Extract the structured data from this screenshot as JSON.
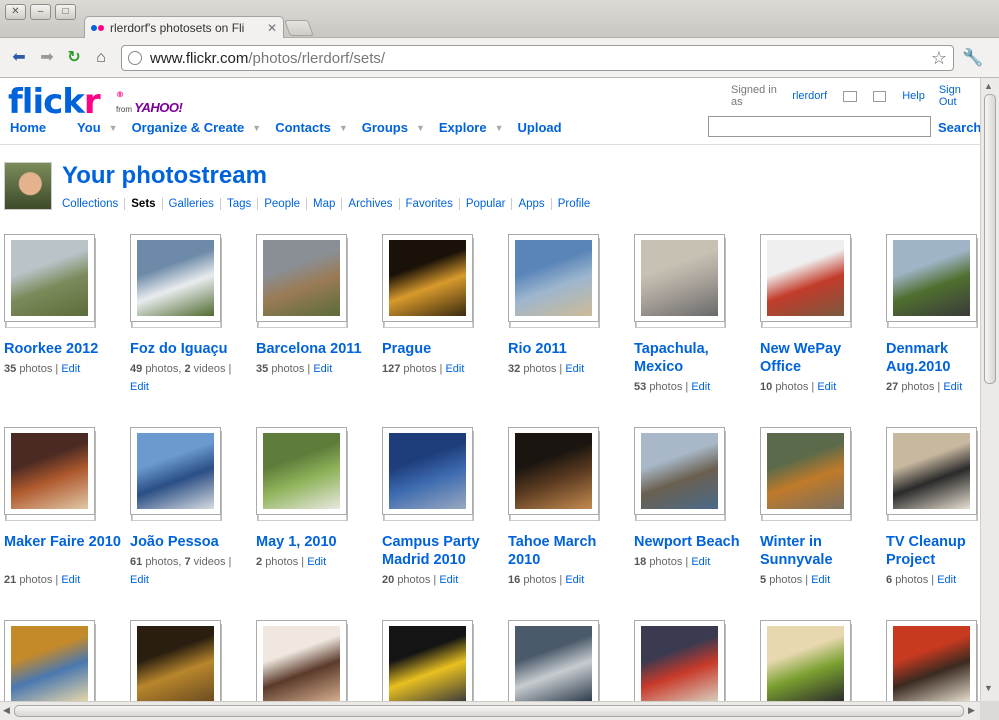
{
  "browser": {
    "tab_title": "rlerdorf's photosets on Fli",
    "url_host": "www.flickr.com",
    "url_path": "/photos/rlerdorf/sets/"
  },
  "header": {
    "logo_text_1": "flick",
    "logo_text_2": "r",
    "logo_from": "from",
    "logo_yahoo": "YAHOO!",
    "signed_in_prefix": "Signed in as",
    "username": "rlerdorf",
    "help": "Help",
    "sign_out": "Sign Out",
    "nav": [
      "Home",
      "You",
      "Organize & Create",
      "Contacts",
      "Groups",
      "Explore",
      "Upload"
    ],
    "search_label": "Search",
    "search_value": ""
  },
  "page": {
    "title": "Your photostream",
    "subnav": [
      "Collections",
      "Sets",
      "Galleries",
      "Tags",
      "People",
      "Map",
      "Archives",
      "Favorites",
      "Popular",
      "Apps",
      "Profile"
    ],
    "active_subnav": "Sets"
  },
  "sets": [
    {
      "title": "Roorkee 2012",
      "photos": "35",
      "videos": "",
      "colors": [
        "#b9c4c9",
        "#7a8a5a",
        "#5d6c3b"
      ]
    },
    {
      "title": "Foz do Iguaçu",
      "photos": "49",
      "videos": "2",
      "colors": [
        "#6d8aa8",
        "#e9ecef",
        "#4f6b2e"
      ]
    },
    {
      "title": "Barcelona 2011",
      "photos": "35",
      "videos": "",
      "colors": [
        "#8a8f96",
        "#9a7b55",
        "#5b6b3a"
      ]
    },
    {
      "title": "Prague",
      "photos": "127",
      "videos": "",
      "colors": [
        "#1a1208",
        "#d89a2c",
        "#3a2a10"
      ]
    },
    {
      "title": "Rio 2011",
      "photos": "32",
      "videos": "",
      "colors": [
        "#5a85b8",
        "#9db6cf",
        "#cdbb96"
      ]
    },
    {
      "title": "Tapachula, Mexico",
      "photos": "53",
      "videos": "",
      "colors": [
        "#c7c1b4",
        "#a9a29a",
        "#6a6a6a"
      ]
    },
    {
      "title": "New WePay Office",
      "photos": "10",
      "videos": "",
      "colors": [
        "#efefef",
        "#c23b2a",
        "#7a5a40"
      ]
    },
    {
      "title": "Denmark Aug.2010",
      "photos": "27",
      "videos": "",
      "colors": [
        "#9fb4c6",
        "#4f6f2f",
        "#3a3a3a"
      ]
    },
    {
      "title": "Maker Faire 2010",
      "photos": "21",
      "videos": "",
      "colors": [
        "#4a2a22",
        "#b05a2e",
        "#e0c8a8"
      ]
    },
    {
      "title": "João Pessoa",
      "photos": "61",
      "videos": "7",
      "colors": [
        "#6a9ad0",
        "#2a4e86",
        "#d8dce0"
      ]
    },
    {
      "title": "May 1, 2010",
      "photos": "2",
      "videos": "",
      "colors": [
        "#5e7d3a",
        "#8fb35a",
        "#e8e8e0"
      ]
    },
    {
      "title": "Campus Party Madrid 2010",
      "photos": "20",
      "videos": "",
      "colors": [
        "#1e3d7a",
        "#3c6ab0",
        "#9aa9c0"
      ]
    },
    {
      "title": "Tahoe March 2010",
      "photos": "16",
      "videos": "",
      "colors": [
        "#1a1510",
        "#5a3a20",
        "#c48a50"
      ]
    },
    {
      "title": "Newport Beach",
      "photos": "18",
      "videos": "",
      "colors": [
        "#a8b8c8",
        "#6a6050",
        "#4a6a8a"
      ]
    },
    {
      "title": "Winter in Sunnyvale",
      "photos": "5",
      "videos": "",
      "colors": [
        "#5a6a4a",
        "#c07a2a",
        "#7a7060"
      ]
    },
    {
      "title": "TV Cleanup Project",
      "photos": "6",
      "videos": "",
      "colors": [
        "#c8b8a0",
        "#2a2a2a",
        "#e8e0d0"
      ]
    },
    {
      "title": "",
      "photos": "",
      "videos": "",
      "colors": [
        "#c48a2a",
        "#4a78b0",
        "#e8d8a8"
      ]
    },
    {
      "title": "",
      "photos": "",
      "videos": "",
      "colors": [
        "#2a1e10",
        "#b8862c",
        "#6a4a20"
      ]
    },
    {
      "title": "",
      "photos": "",
      "videos": "",
      "colors": [
        "#f0e8e0",
        "#5a3a2a",
        "#d8b090"
      ]
    },
    {
      "title": "",
      "photos": "",
      "videos": "",
      "colors": [
        "#141414",
        "#e8c020",
        "#3a3a3a"
      ]
    },
    {
      "title": "",
      "photos": "",
      "videos": "",
      "colors": [
        "#4a5a6a",
        "#c8ccd0",
        "#2a3a4a"
      ]
    },
    {
      "title": "",
      "photos": "",
      "videos": "",
      "colors": [
        "#3a3a50",
        "#c83a2a",
        "#d8d0c0"
      ]
    },
    {
      "title": "",
      "photos": "",
      "videos": "",
      "colors": [
        "#e8d8b0",
        "#7aa030",
        "#2a2a2a"
      ]
    },
    {
      "title": "",
      "photos": "",
      "videos": "",
      "colors": [
        "#c83a20",
        "#3a2a20",
        "#e8e0d0"
      ]
    }
  ],
  "labels": {
    "photos_word": "photos",
    "videos_word": "videos",
    "edit": "Edit"
  }
}
